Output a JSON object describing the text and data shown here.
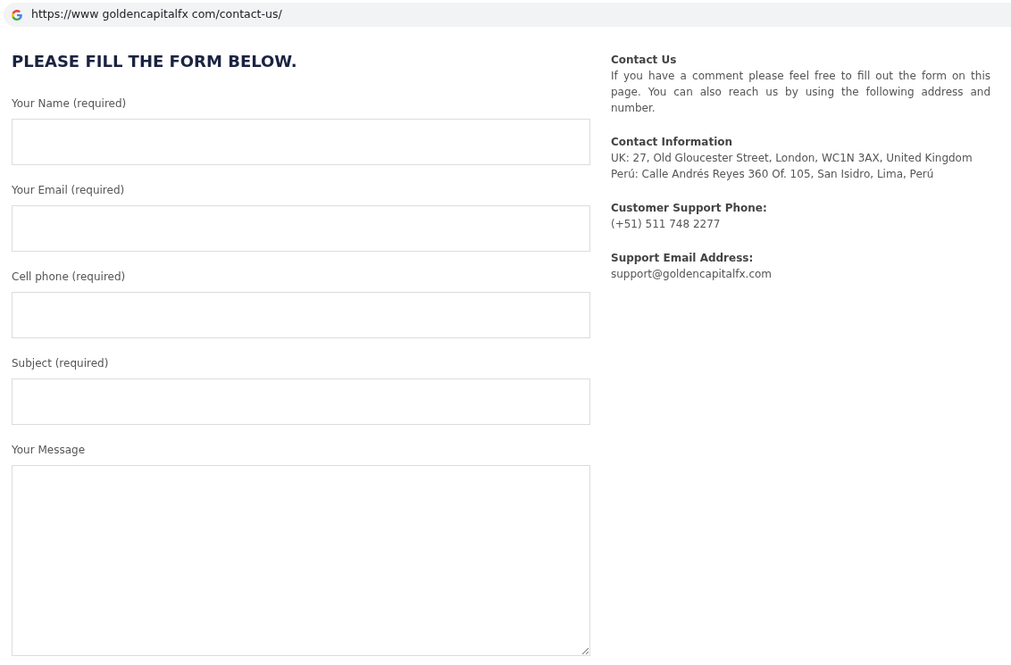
{
  "browser": {
    "url": "https://www goldencapitalfx com/contact-us/"
  },
  "form": {
    "title": "PLEASE FILL THE FORM BELOW.",
    "fields": [
      {
        "label": "Your Name (required)",
        "kind": "input"
      },
      {
        "label": "Your Email (required)",
        "kind": "input"
      },
      {
        "label": "Cell phone (required)",
        "kind": "input"
      },
      {
        "label": "Subject (required)",
        "kind": "input"
      },
      {
        "label": "Your Message",
        "kind": "textarea"
      }
    ]
  },
  "sidebar": {
    "sections": [
      {
        "heading": "Contact Us",
        "lines": [
          "If you have a comment please feel free to fill out the form on this page. You can also reach us by using the following address and number."
        ]
      },
      {
        "heading": "Contact Information",
        "lines": [
          "UK: 27, Old Gloucester Street, London, WC1N 3AX, United Kingdom",
          "Perú: Calle Andrés Reyes 360 Of. 105, San Isidro, Lima, Perú"
        ]
      },
      {
        "heading": "Customer Support Phone:",
        "lines": [
          "(+51) 511 748 2277"
        ]
      },
      {
        "heading": "Support Email Address:",
        "lines": [
          "support@goldencapitalfx.com"
        ]
      }
    ]
  }
}
